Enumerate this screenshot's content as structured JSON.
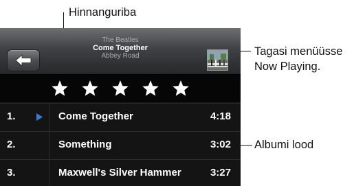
{
  "callouts": {
    "rating": "Hinnanguriba",
    "back_line1": "Tagasi menüüsse",
    "back_line2": "Now Playing.",
    "tracks": "Albumi lood"
  },
  "now_playing": {
    "artist": "The Beatles",
    "song": "Come Together",
    "album": "Abbey Road"
  },
  "back_button": {
    "icon": "back-arrow-icon"
  },
  "rating": {
    "stars": 5,
    "max": 5
  },
  "colors": {
    "play_indicator": "#3b7bd6",
    "header_bg": "#3f4144",
    "list_bg": "#141414"
  },
  "tracks": [
    {
      "number": "1.",
      "title": "Come Together",
      "time": "4:18",
      "playing": true
    },
    {
      "number": "2.",
      "title": "Something",
      "time": "3:02",
      "playing": false
    },
    {
      "number": "3.",
      "title": "Maxwell's Silver Hammer",
      "time": "3:27",
      "playing": false
    }
  ]
}
